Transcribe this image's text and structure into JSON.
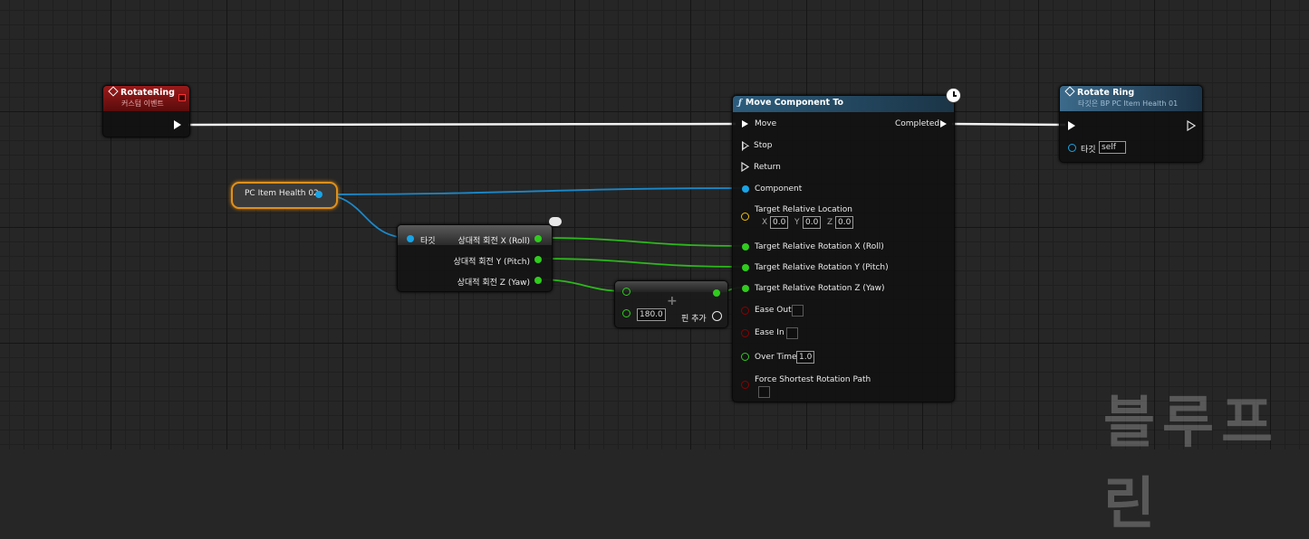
{
  "event_node": {
    "title": "RotateRing",
    "subtitle": "커스텀 이벤트",
    "color": "#8a1414"
  },
  "var_node": {
    "label": "PC Item Health 02"
  },
  "break_node": {
    "target_label": "타깃",
    "outputs": [
      "상대적 회전 X (Roll)",
      "상대적 회전 Y (Pitch)",
      "상대적 회전 Z (Yaw)"
    ]
  },
  "add_node": {
    "value": "180.0",
    "add_pin_label": "핀 추가"
  },
  "move_node": {
    "title": "Move Component To",
    "func_symbol": "ƒ",
    "exec_inputs": [
      "Move",
      "Stop",
      "Return"
    ],
    "exec_output": "Completed",
    "component_label": "Component",
    "location": {
      "label": "Target Relative Location",
      "x_label": "X",
      "x": "0.0",
      "y_label": "Y",
      "y": "0.0",
      "z_label": "Z",
      "z": "0.0"
    },
    "rotation_x": "Target Relative Rotation X (Roll)",
    "rotation_y": "Target Relative Rotation Y (Pitch)",
    "rotation_z": "Target Relative Rotation Z (Yaw)",
    "ease_out": "Ease Out",
    "ease_in": "Ease In",
    "over_time": {
      "label": "Over Time",
      "value": "1.0"
    },
    "force_shortest": "Force Shortest Rotation Path"
  },
  "call_node": {
    "title": "Rotate Ring",
    "subtitle": "타깃은 BP PC Item Health 01",
    "target_label": "타깃",
    "target_value": "self"
  },
  "watermark": "블루프린",
  "colors": {
    "exec": "#ffffff",
    "object": "#19a4e6",
    "float": "#2fcc1d",
    "vector": "#f0c000",
    "bool": "#8b0000"
  }
}
